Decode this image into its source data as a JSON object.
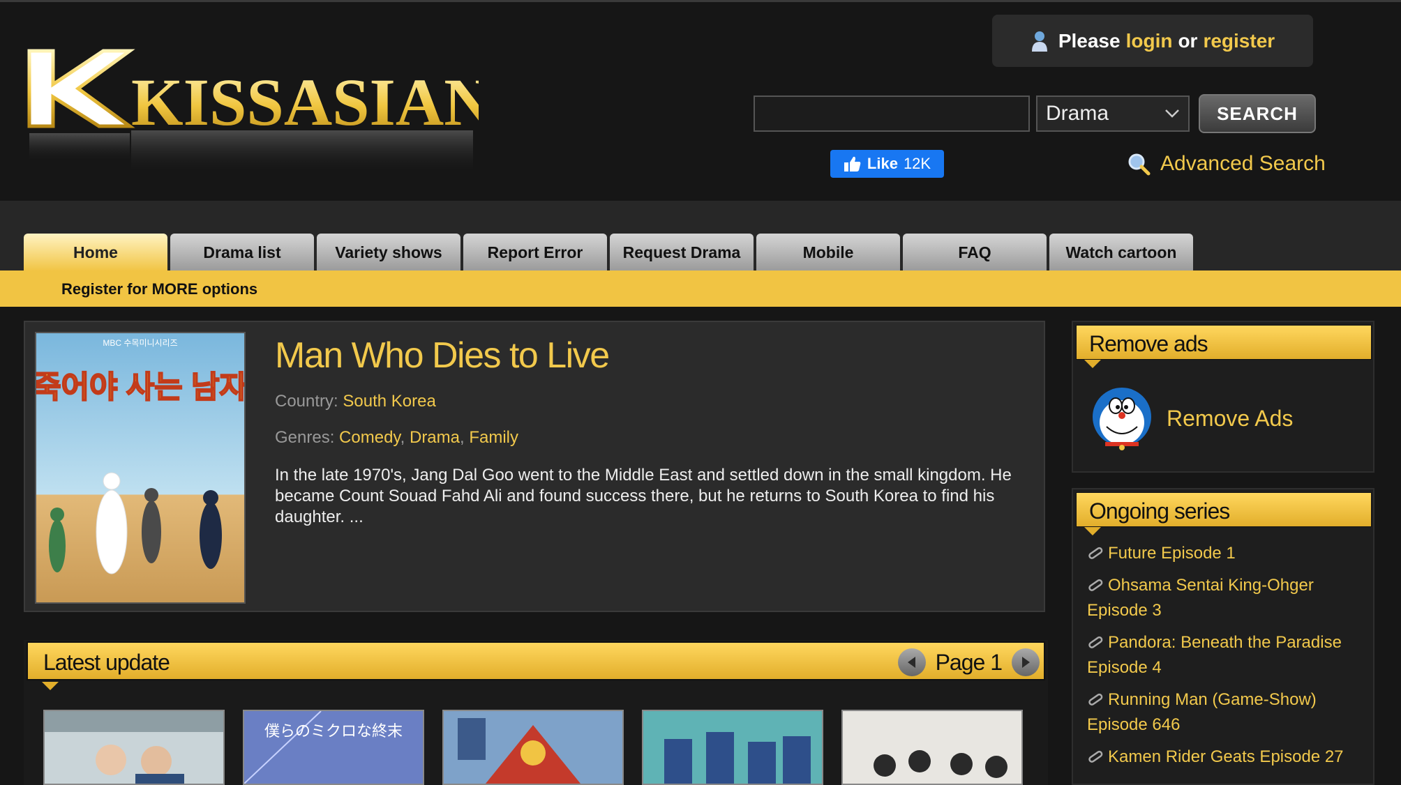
{
  "header": {
    "logo_text": "KISSASIAN",
    "login_prefix": "Please",
    "login_link": "login",
    "login_or": "or",
    "register_link": "register",
    "search_placeholder": "",
    "search_type": "Drama",
    "search_button": "SEARCH",
    "fb_like_label": "Like",
    "fb_like_count": "12K",
    "advanced_search": "Advanced Search"
  },
  "nav": {
    "tabs": [
      "Home",
      "Drama list",
      "Variety shows",
      "Report Error",
      "Request Drama",
      "Mobile",
      "FAQ",
      "Watch cartoon"
    ],
    "active": "Home",
    "sub_text": "Register for MORE options"
  },
  "featured": {
    "title": "Man Who Dies to Live",
    "country_label": "Country:",
    "country": "South Korea",
    "genres_label": "Genres:",
    "genres": [
      "Comedy",
      "Drama",
      "Family"
    ],
    "description": "In the late 1970's, Jang Dal Goo went to the Middle East and settled down in the small kingdom. He became Count Souad Fahd Ali and found success there, but he returns to South Korea to find his daughter. ...",
    "poster_title": "죽어야 사는 남자",
    "poster_header": "MBC 수목미니시리즈"
  },
  "latest": {
    "title": "Latest update",
    "page_label": "Page 1",
    "thumbs": [
      {
        "caption": ""
      },
      {
        "caption": "僕らのミクロな終末"
      },
      {
        "caption": ""
      },
      {
        "caption": ""
      },
      {
        "caption": ""
      }
    ]
  },
  "sidebar": {
    "remove_ads_title": "Remove ads",
    "remove_ads_link": "Remove Ads",
    "ongoing_title": "Ongoing series",
    "ongoing": [
      "Future Episode 1",
      "Ohsama Sentai King-Ohger Episode 3",
      "Pandora: Beneath the Paradise Episode 4",
      "Running Man (Game-Show) Episode 646",
      "Kamen Rider Geats Episode 27"
    ]
  },
  "colors": {
    "accent": "#f2c94c",
    "background": "#161616",
    "facebook": "#1877f2"
  },
  "icons": {
    "user": "user-icon",
    "search": "magnifier-icon",
    "like": "thumbs-up-icon",
    "link": "link-icon",
    "prev": "arrow-left-icon",
    "next": "arrow-right-icon",
    "mascot": "doraemon-icon"
  }
}
